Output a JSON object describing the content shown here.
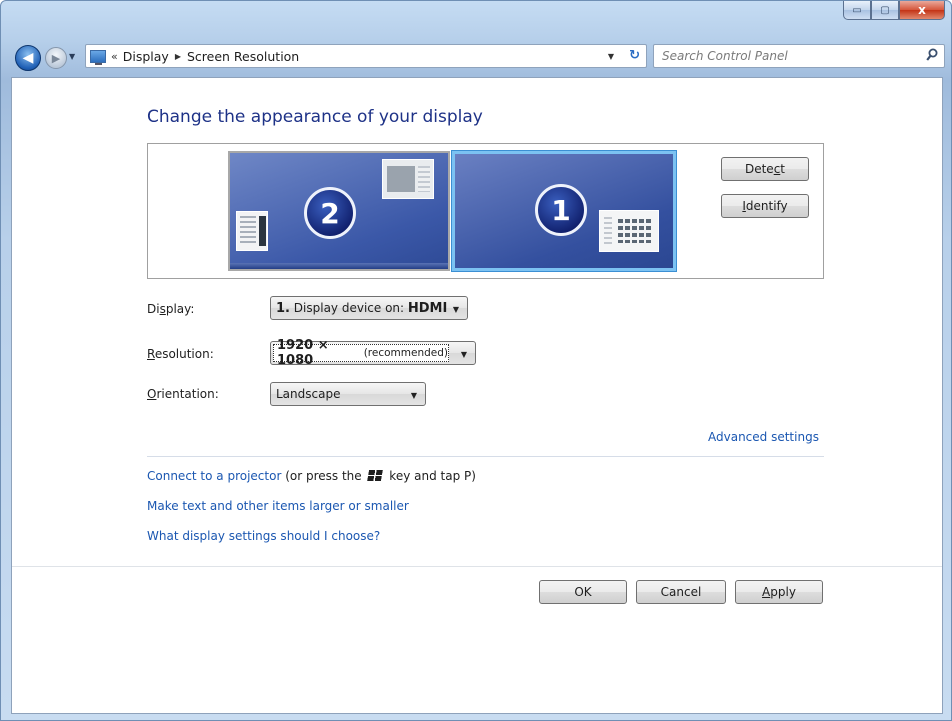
{
  "window": {
    "caption_min": "▭",
    "caption_max": "▢",
    "caption_close": "x"
  },
  "nav": {
    "breadcrumb_overflow": "«",
    "crumbs": [
      "Display",
      "Screen Resolution"
    ],
    "search_placeholder": "Search Control Panel"
  },
  "page": {
    "title": "Change the appearance of your display",
    "monitors": [
      {
        "number": "2",
        "selected": false
      },
      {
        "number": "1",
        "selected": true
      }
    ],
    "detect_pre": "Dete",
    "detect_key": "c",
    "detect_post": "t",
    "identify_key": "I",
    "identify_post": "dentify",
    "display_label_pre": "Di",
    "display_label_key": "s",
    "display_label_post": "play:",
    "display_value_num": "1.",
    "display_value_text": " Display device on: ",
    "display_value_port": "HDMI",
    "resolution_label_key": "R",
    "resolution_label_post": "esolution:",
    "resolution_value": "1920 × 1080",
    "resolution_note": " (recommended)",
    "orientation_label_key": "O",
    "orientation_label_post": "rientation:",
    "orientation_value": "Landscape",
    "advanced_link": "Advanced settings",
    "projector_link": "Connect to a projector",
    "projector_hint_pre": " (or press the ",
    "projector_hint_post": " key and tap P)",
    "text_size_link": "Make text and other items larger or smaller",
    "help_link": "What display settings should I choose?"
  },
  "footer": {
    "ok": "OK",
    "cancel": "Cancel",
    "apply_key": "A",
    "apply_post": "pply"
  },
  "colors": {
    "link": "#1b57b1",
    "title": "#1e3287",
    "selected_monitor_border": "#7cc2f2"
  }
}
